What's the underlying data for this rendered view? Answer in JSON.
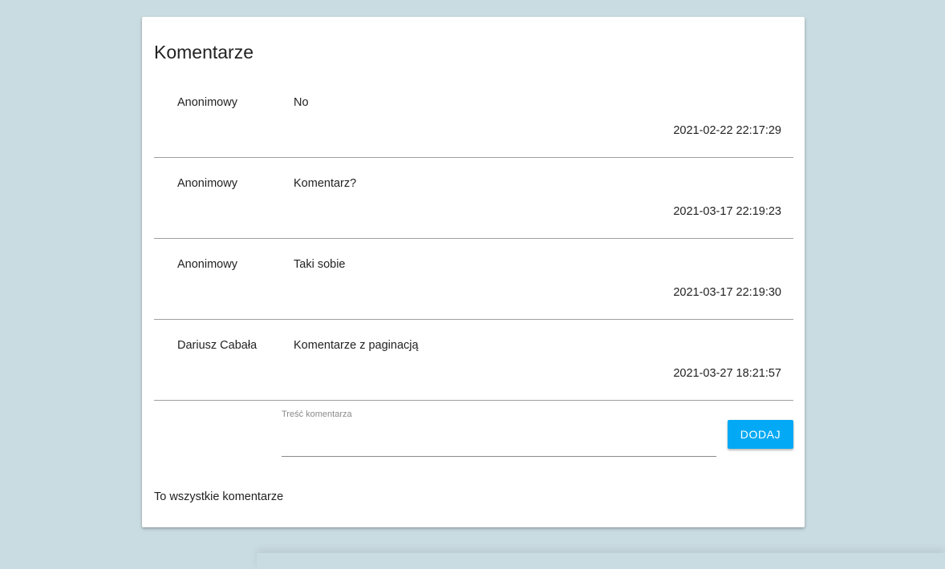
{
  "section": {
    "title": "Komentarze"
  },
  "comments": [
    {
      "author": "Anonimowy",
      "text": "No",
      "date": "2021-02-22 22:17:29"
    },
    {
      "author": "Anonimowy",
      "text": "Komentarz?",
      "date": "2021-03-17 22:19:23"
    },
    {
      "author": "Anonimowy",
      "text": "Taki sobie",
      "date": "2021-03-17 22:19:30"
    },
    {
      "author": "Dariusz Cabała",
      "text": "Komentarze z paginacją",
      "date": "2021-03-27 18:21:57"
    }
  ],
  "form": {
    "field_label": "Treść komentarza",
    "field_value": "",
    "submit_label": "DODAJ"
  },
  "footer": {
    "note": "To wszystkie komentarze"
  },
  "colors": {
    "background": "#c9dce2",
    "accent": "#03a9f4"
  }
}
